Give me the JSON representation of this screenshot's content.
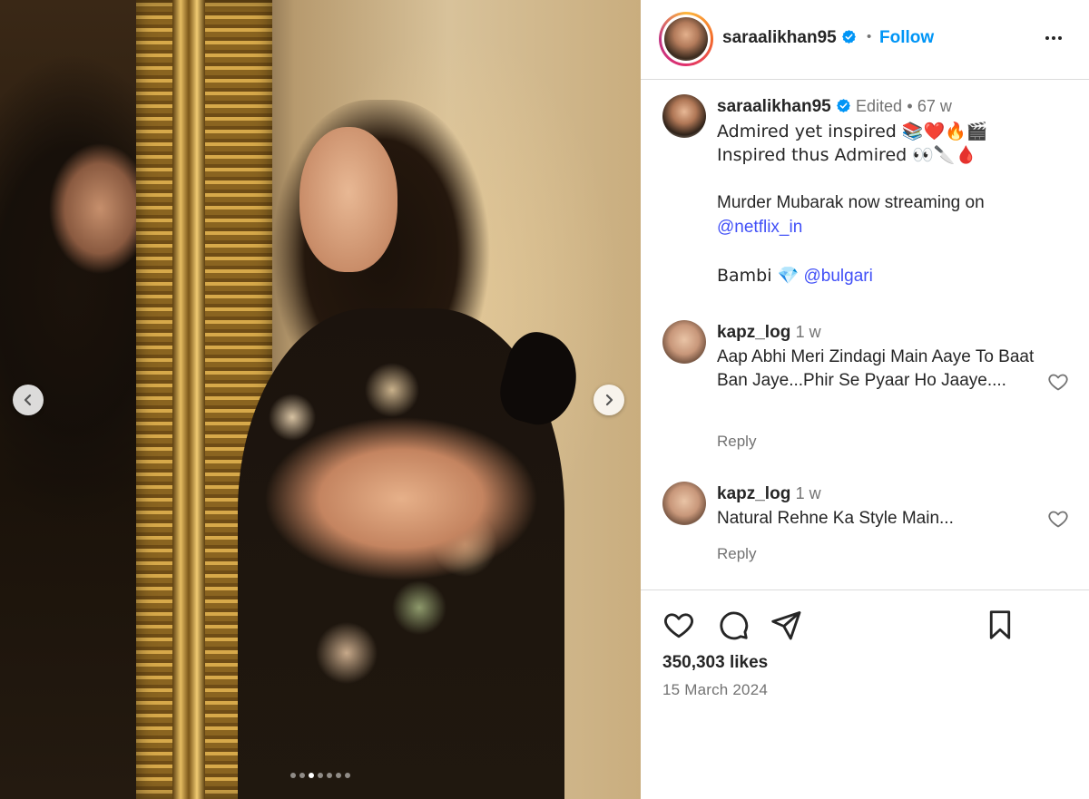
{
  "post": {
    "image_description_alt": "",
    "carousel": {
      "dot_count": 7,
      "active_index": 2
    }
  },
  "header": {
    "username": "saraalikhan95",
    "separator": "•",
    "follow_label": "Follow"
  },
  "caption": {
    "username": "saraalikhan95",
    "edited_label": "Edited",
    "separator": "•",
    "age": "67 w",
    "line1": "Admired yet inspired 📚❤️🔥🎬",
    "line2": "Inspired thus Admired 👀🔪🩸",
    "line3": "Murder Mubarak now streaming on",
    "mention1": "@netflix_in",
    "line4": "Bambi 💎",
    "mention2": "@bulgari"
  },
  "comments": [
    {
      "username": "kapz_log",
      "age": "1 w",
      "text": "Aap Abhi Meri Zindagi Main Aaye To Baat Ban Jaye...Phir Se Pyaar Ho Jaaye....",
      "reply_label": "Reply"
    },
    {
      "username": "kapz_log",
      "age": "1 w",
      "text": "Natural Rehne Ka Style Main...",
      "reply_label": "Reply"
    }
  ],
  "stats": {
    "likes": "350,303 likes",
    "date": "15 March 2024"
  },
  "icons": {
    "verified": "verified-badge-icon",
    "more": "more-options-icon",
    "like": "heart-icon",
    "comment": "comment-icon",
    "share": "share-icon",
    "save": "bookmark-icon",
    "prev": "chevron-left-icon",
    "next": "chevron-right-icon"
  },
  "colors": {
    "link": "#0095f6",
    "mention": "#4150f7",
    "muted": "#737373",
    "text": "#262626",
    "verified": "#0095f6"
  }
}
